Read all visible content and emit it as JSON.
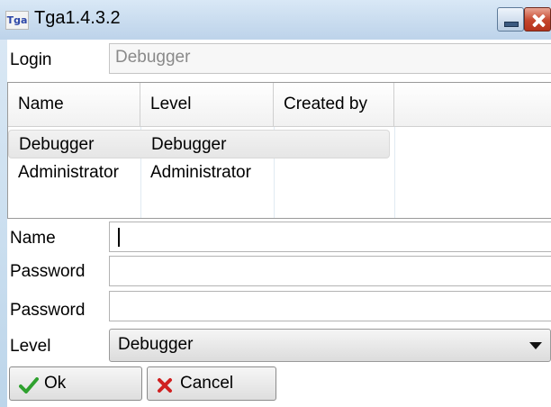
{
  "window": {
    "title": "Tga1.4.3.2",
    "icon_text": "Tga",
    "icons": {
      "app": "app-logo-icon",
      "minimize": "minimize-icon",
      "close": "close-icon"
    }
  },
  "login": {
    "label": "Login",
    "value": "Debugger"
  },
  "grid": {
    "columns": [
      "Name",
      "Level",
      "Created by"
    ],
    "rows": [
      {
        "name": "Debugger",
        "level": "Debugger",
        "created_by": ""
      },
      {
        "name": "Administrator",
        "level": "Administrator",
        "created_by": ""
      }
    ],
    "selected_row": 0
  },
  "form": {
    "name_label": "Name",
    "name_value": "",
    "password_label": "Password",
    "password_confirm_label": "Password",
    "level_label": "Level",
    "level_value": "Debugger"
  },
  "buttons": {
    "ok_label": "Ok",
    "cancel_label": "Cancel",
    "ok_icon": "checkmark-icon",
    "cancel_icon": "cross-icon"
  },
  "colors": {
    "accent": "#4a8bd0",
    "ok_icon": "#2fa12f",
    "cancel_icon": "#d02020",
    "close_button": "#c5452c"
  }
}
